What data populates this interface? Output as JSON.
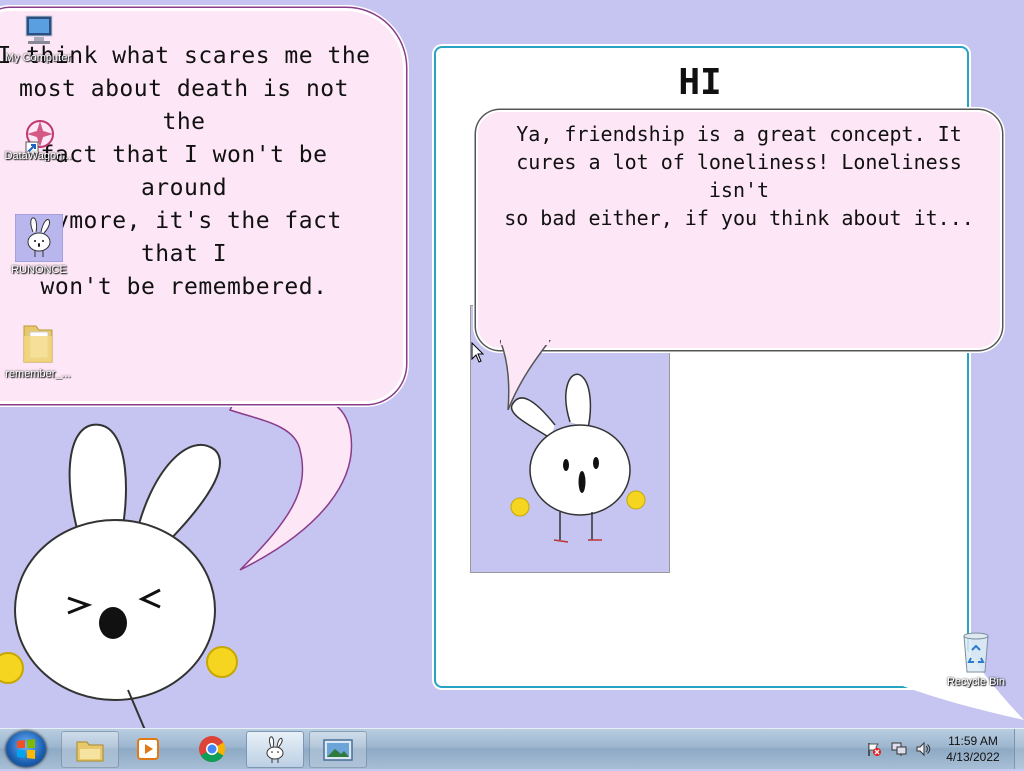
{
  "desktop": {
    "icons": [
      {
        "label": "My Computer"
      },
      {
        "label": "DataWagon..."
      },
      {
        "label": "RUNONCE"
      },
      {
        "label": "remember_..."
      },
      {
        "label": "Recycle Bin"
      }
    ]
  },
  "left_bubble": {
    "lines": [
      "I think what scares me the",
      "most about death is not the",
      "fact that I won't be around",
      "anymore, it's the fact that I",
      "won't be remembered."
    ]
  },
  "right_panel": {
    "title": "HI",
    "bubble_lines": [
      "Ya, friendship is a great concept. It",
      "cures a lot of loneliness! Loneliness isn't",
      "so bad either, if you think about it..."
    ]
  },
  "taskbar": {
    "items": [
      "start-orb-icon",
      "explorer-icon",
      "media-player-icon",
      "chrome-icon",
      "bunny-app-icon",
      "photo-viewer-icon"
    ],
    "clock_time": "11:59 AM",
    "clock_date": "4/13/2022"
  },
  "colors": {
    "desktop_bg": "#c6c5f1",
    "bubble_pink": "#fde6f6",
    "panel_border": "#27a3c4",
    "taskbar": "#9cb6cf"
  }
}
